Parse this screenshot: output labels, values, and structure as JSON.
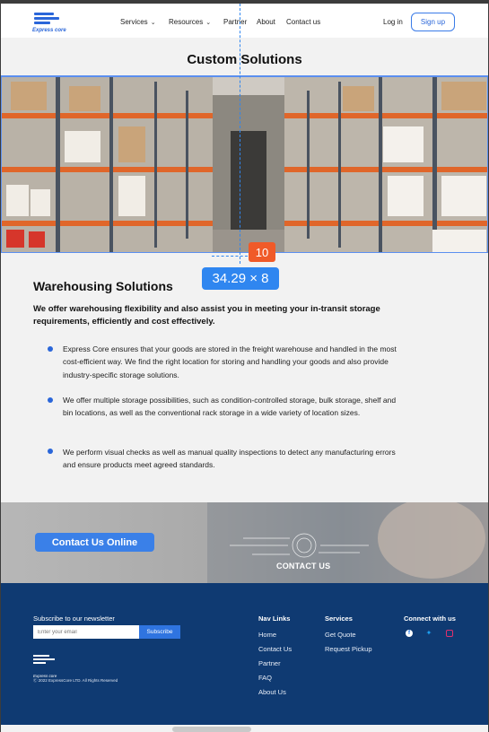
{
  "brand": {
    "logo_text": "Express core",
    "accent": "#2a66d9"
  },
  "nav": {
    "items": [
      {
        "label": "Services",
        "dropdown": true
      },
      {
        "label": "Resources",
        "dropdown": true
      },
      {
        "label": "Partner",
        "dropdown": false
      },
      {
        "label": "About",
        "dropdown": false
      },
      {
        "label": "Contact us",
        "dropdown": false
      }
    ],
    "login": "Log in",
    "signup": "Sign up"
  },
  "page": {
    "title": "Custom Solutions"
  },
  "hero": {
    "image": "warehouse-aisle-image"
  },
  "overlay": {
    "spacing_badge": "10",
    "dimension_badge": "34.29 × 8"
  },
  "section": {
    "title": "Warehousing Solutions",
    "lead": "We offer warehousing flexibility and also assist you in meeting your in-transit storage requirements, efficiently and cost effectively.",
    "bullets": [
      "Express Core ensures that your goods are stored in the freight warehouse and handled in the most cost-efficient way. We find the right location for storing and handling your goods and also provide industry-specific storage solutions.",
      "We offer multiple storage possibilities, such as condition-controlled storage, bulk storage, shelf and bin locations, as well as the conventional rack storage in a wide variety of location sizes.",
      "We perform visual checks as well as manual quality inspections to detect any manufacturing errors and ensure products meet agreed standards."
    ]
  },
  "cta": {
    "button": "Contact Us Online",
    "image_caption": "CONTACT US"
  },
  "footer": {
    "newsletter_label": "Subscribe to our newsletter",
    "email_placeholder": "Enter your email",
    "subscribe": "Subscribe",
    "copyright": "Ⓒ 2022 ExpressCore LTD. All Rights Reserved",
    "nav_links_title": "Nav Links",
    "nav_links": [
      "Home",
      "Contact Us",
      "Partner",
      "FAQ",
      "About Us"
    ],
    "services_title": "Services",
    "services": [
      "Get Quote",
      "Request Pickup"
    ],
    "connect_title": "Connect with us",
    "social": [
      {
        "icon": "facebook-icon",
        "color": "#1877f2"
      },
      {
        "icon": "twitter-icon",
        "color": "#1da1f2"
      },
      {
        "icon": "instagram-icon",
        "color": "#e1306c"
      }
    ]
  }
}
